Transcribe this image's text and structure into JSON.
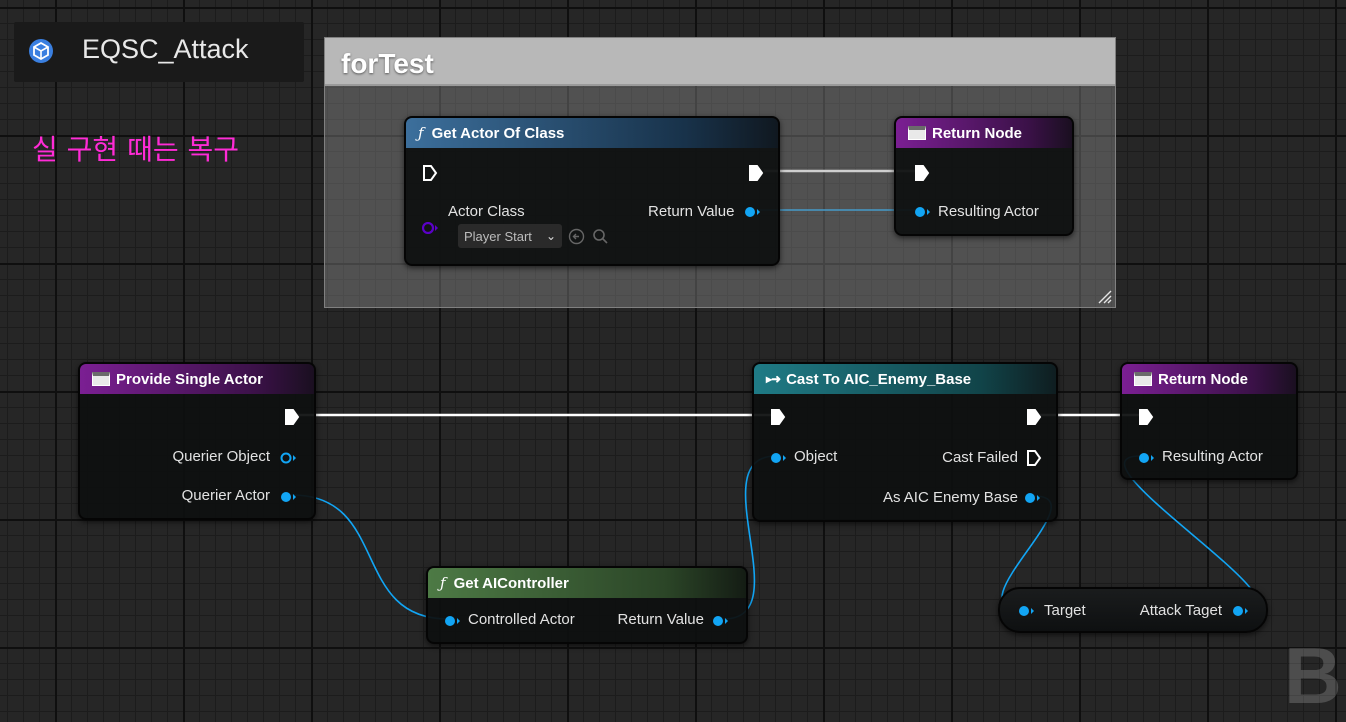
{
  "graph_title": "EQSC_Attack",
  "comment_note": "실 구현 때는 복구",
  "comment_box": {
    "title": "forTest"
  },
  "nodes": {
    "get_actor_of_class": {
      "title": "Get Actor Of Class",
      "actor_class_label": "Actor Class",
      "actor_class_value": "Player Start",
      "return_value_label": "Return Value"
    },
    "return_node_test": {
      "title": "Return Node",
      "resulting_actor_label": "Resulting Actor"
    },
    "provide_single_actor": {
      "title": "Provide Single Actor",
      "querier_object_label": "Querier Object",
      "querier_actor_label": "Querier Actor"
    },
    "cast_to_aic_enemy_base": {
      "title": "Cast To AIC_Enemy_Base",
      "object_label": "Object",
      "cast_failed_label": "Cast Failed",
      "as_label": "As AIC Enemy Base"
    },
    "return_node_main": {
      "title": "Return Node",
      "resulting_actor_label": "Resulting Actor"
    },
    "get_ai_controller": {
      "title": "Get AIController",
      "controlled_actor_label": "Controlled Actor",
      "return_value_label": "Return Value"
    },
    "attack_target_var": {
      "target_label": "Target",
      "attack_taget_label": "Attack Taget"
    }
  },
  "colors": {
    "object_pin": "#12a5f4",
    "class_pin": "#5b00c8",
    "exec_pin": "#ffffff",
    "comment_note_text": "#ff2bd6"
  },
  "icons": [
    "blueprint-cube-icon",
    "function-icon",
    "return-node-icon",
    "cast-icon",
    "resize-grip-icon",
    "chevron-down-icon",
    "use-selected-icon",
    "browse-search-icon"
  ],
  "watermark": "BI"
}
